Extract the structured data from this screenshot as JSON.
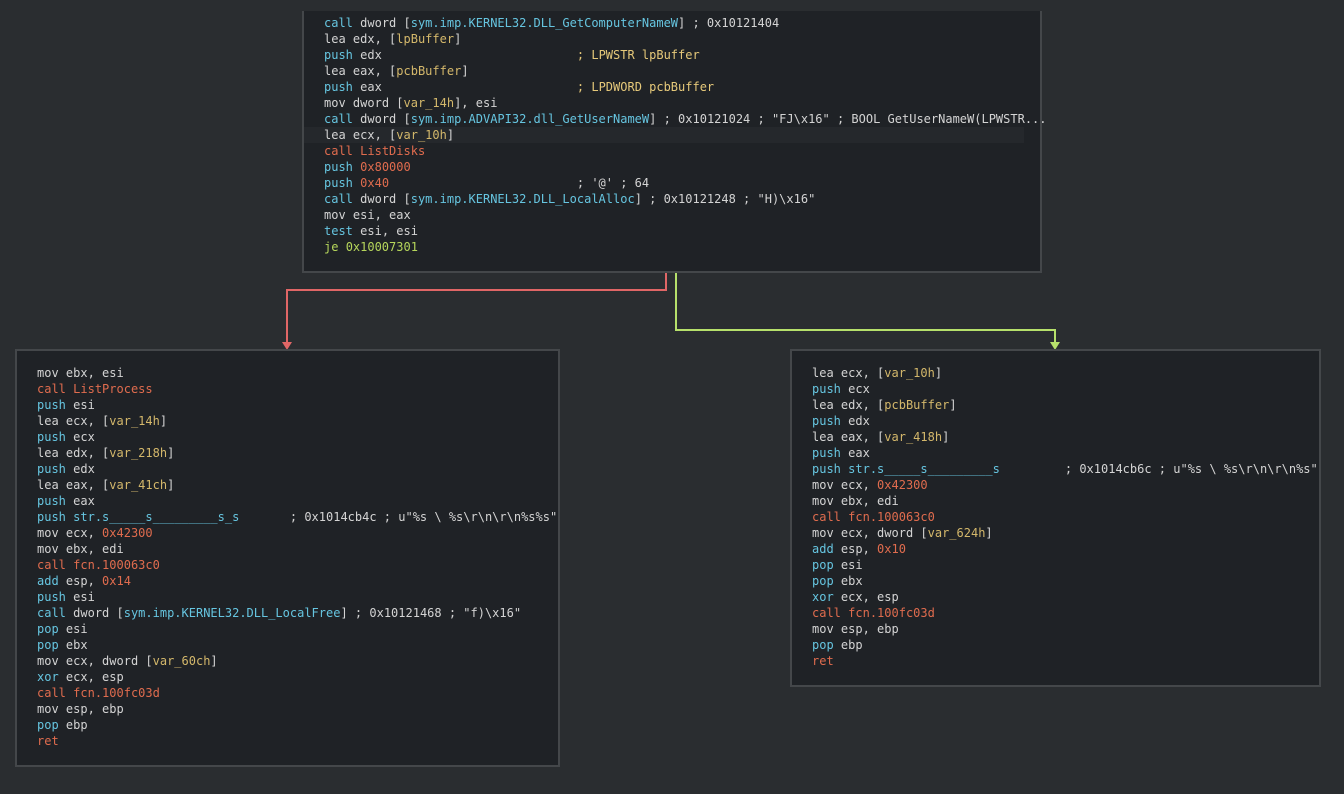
{
  "blocks": {
    "top": {
      "lines": [
        {
          "m": "call",
          "mk": "k-call-imp",
          "parts": [
            [
              "op",
              "dword ["
            ],
            [
              "imp",
              "sym.imp.KERNEL32.DLL_GetComputerNameW"
            ],
            [
              "op",
              "] ; 0x10121404"
            ]
          ]
        },
        {
          "m": "lea",
          "mk": "",
          "parts": [
            [
              "op",
              "edx, ["
            ],
            [
              "var",
              "lpBuffer"
            ],
            [
              "op",
              "]"
            ]
          ]
        },
        {
          "m": "push",
          "mk": "k-push",
          "parts": [
            [
              "op",
              "edx                           "
            ],
            [
              "cmt",
              "; LPWSTR lpBuffer"
            ]
          ]
        },
        {
          "m": "lea",
          "mk": "",
          "parts": [
            [
              "op",
              "eax, ["
            ],
            [
              "var",
              "pcbBuffer"
            ],
            [
              "op",
              "]"
            ]
          ]
        },
        {
          "m": "push",
          "mk": "k-push",
          "parts": [
            [
              "op",
              "eax                           "
            ],
            [
              "cmt",
              "; LPDWORD pcbBuffer"
            ]
          ]
        },
        {
          "m": "mov",
          "mk": "",
          "parts": [
            [
              "op",
              "dword ["
            ],
            [
              "var",
              "var_14h"
            ],
            [
              "op",
              "], esi"
            ]
          ]
        },
        {
          "m": "call",
          "mk": "k-call-imp",
          "parts": [
            [
              "op",
              "dword ["
            ],
            [
              "imp",
              "sym.imp.ADVAPI32.dll_GetUserNameW"
            ],
            [
              "op",
              "] ; 0x10121024 ; \"FJ\\x16\" ; BOOL GetUserNameW(LPWSTR..."
            ]
          ]
        },
        {
          "m": "lea",
          "mk": "",
          "hl": true,
          "parts": [
            [
              "op",
              "ecx, ["
            ],
            [
              "var",
              "var_10h"
            ],
            [
              "op",
              "]"
            ]
          ]
        },
        {
          "m": "call",
          "mk": "k-call-fn",
          "parts": [
            [
              "fn",
              "ListDisks"
            ]
          ]
        },
        {
          "m": "push",
          "mk": "k-push",
          "parts": [
            [
              "num",
              "0x80000"
            ]
          ]
        },
        {
          "m": "push",
          "mk": "k-push",
          "parts": [
            [
              "num",
              "0x40"
            ],
            [
              "op",
              "                          ; '@' ; 64"
            ]
          ]
        },
        {
          "m": "call",
          "mk": "k-call-imp",
          "parts": [
            [
              "op",
              "dword ["
            ],
            [
              "imp",
              "sym.imp.KERNEL32.DLL_LocalAlloc"
            ],
            [
              "op",
              "] ; 0x10121248 ; \"H)\\x16\""
            ]
          ]
        },
        {
          "m": "mov",
          "mk": "",
          "parts": [
            [
              "op",
              "esi, eax"
            ]
          ]
        },
        {
          "m": "test",
          "mk": "k-test",
          "parts": [
            [
              "op",
              "esi, esi"
            ]
          ]
        },
        {
          "m": "je",
          "mk": "k-je",
          "parts": [
            [
              "addr",
              "0x10007301"
            ]
          ]
        }
      ]
    },
    "left": {
      "lines": [
        {
          "m": "mov",
          "mk": "",
          "parts": [
            [
              "op",
              "ebx, esi"
            ]
          ]
        },
        {
          "m": "call",
          "mk": "k-call-fn",
          "parts": [
            [
              "fn",
              "ListProcess"
            ]
          ]
        },
        {
          "m": "push",
          "mk": "k-push",
          "parts": [
            [
              "op",
              "esi"
            ]
          ]
        },
        {
          "m": "lea",
          "mk": "",
          "parts": [
            [
              "op",
              "ecx, ["
            ],
            [
              "var",
              "var_14h"
            ],
            [
              "op",
              "]"
            ]
          ]
        },
        {
          "m": "push",
          "mk": "k-push",
          "parts": [
            [
              "op",
              "ecx"
            ]
          ]
        },
        {
          "m": "lea",
          "mk": "",
          "parts": [
            [
              "op",
              "edx, ["
            ],
            [
              "var",
              "var_218h"
            ],
            [
              "op",
              "]"
            ]
          ]
        },
        {
          "m": "push",
          "mk": "k-push",
          "parts": [
            [
              "op",
              "edx"
            ]
          ]
        },
        {
          "m": "lea",
          "mk": "",
          "parts": [
            [
              "op",
              "eax, ["
            ],
            [
              "var",
              "var_41ch"
            ],
            [
              "op",
              "]"
            ]
          ]
        },
        {
          "m": "push",
          "mk": "k-push",
          "parts": [
            [
              "op",
              "eax"
            ]
          ]
        },
        {
          "m": "push",
          "mk": "k-push",
          "parts": [
            [
              "str",
              "str.s_____s_________s_s"
            ],
            [
              "op",
              "       ; 0x1014cb4c ; u\"%s \\ %s\\r\\n\\r\\n%s%s\""
            ]
          ]
        },
        {
          "m": "mov",
          "mk": "",
          "parts": [
            [
              "op",
              "ecx, "
            ],
            [
              "num",
              "0x42300"
            ]
          ]
        },
        {
          "m": "mov",
          "mk": "",
          "parts": [
            [
              "op",
              "ebx, edi"
            ]
          ]
        },
        {
          "m": "call",
          "mk": "k-call-fn",
          "parts": [
            [
              "fn",
              "fcn.100063c0"
            ]
          ]
        },
        {
          "m": "add",
          "mk": "k-add",
          "parts": [
            [
              "op",
              "esp, "
            ],
            [
              "num",
              "0x14"
            ]
          ]
        },
        {
          "m": "push",
          "mk": "k-push",
          "parts": [
            [
              "op",
              "esi"
            ]
          ]
        },
        {
          "m": "call",
          "mk": "k-call-imp",
          "parts": [
            [
              "op",
              "dword ["
            ],
            [
              "imp",
              "sym.imp.KERNEL32.DLL_LocalFree"
            ],
            [
              "op",
              "] ; 0x10121468 ; \"f)\\x16\""
            ]
          ]
        },
        {
          "m": "pop",
          "mk": "k-pop",
          "parts": [
            [
              "op",
              "esi"
            ]
          ]
        },
        {
          "m": "pop",
          "mk": "k-pop",
          "parts": [
            [
              "op",
              "ebx"
            ]
          ]
        },
        {
          "m": "mov",
          "mk": "",
          "parts": [
            [
              "op",
              "ecx, dword ["
            ],
            [
              "var",
              "var_60ch"
            ],
            [
              "op",
              "]"
            ]
          ]
        },
        {
          "m": "xor",
          "mk": "k-xor",
          "parts": [
            [
              "op",
              "ecx, esp"
            ]
          ]
        },
        {
          "m": "call",
          "mk": "k-call-fn",
          "parts": [
            [
              "fn",
              "fcn.100fc03d"
            ]
          ]
        },
        {
          "m": "mov",
          "mk": "",
          "parts": [
            [
              "op",
              "esp, ebp"
            ]
          ]
        },
        {
          "m": "pop",
          "mk": "k-pop",
          "parts": [
            [
              "op",
              "ebp"
            ]
          ]
        },
        {
          "m": "ret",
          "mk": "k-ret",
          "parts": []
        }
      ]
    },
    "right": {
      "lines": [
        {
          "m": "lea",
          "mk": "",
          "parts": [
            [
              "op",
              "ecx, ["
            ],
            [
              "var",
              "var_10h"
            ],
            [
              "op",
              "]"
            ]
          ]
        },
        {
          "m": "push",
          "mk": "k-push",
          "parts": [
            [
              "op",
              "ecx"
            ]
          ]
        },
        {
          "m": "lea",
          "mk": "",
          "parts": [
            [
              "op",
              "edx, ["
            ],
            [
              "var",
              "pcbBuffer"
            ],
            [
              "op",
              "]"
            ]
          ]
        },
        {
          "m": "push",
          "mk": "k-push",
          "parts": [
            [
              "op",
              "edx"
            ]
          ]
        },
        {
          "m": "lea",
          "mk": "",
          "parts": [
            [
              "op",
              "eax, ["
            ],
            [
              "var",
              "var_418h"
            ],
            [
              "op",
              "]"
            ]
          ]
        },
        {
          "m": "push",
          "mk": "k-push",
          "parts": [
            [
              "op",
              "eax"
            ]
          ]
        },
        {
          "m": "push",
          "mk": "k-push",
          "parts": [
            [
              "str",
              "str.s_____s_________s"
            ],
            [
              "op",
              "         ; 0x1014cb6c ; u\"%s \\ %s\\r\\n\\r\\n%s\""
            ]
          ]
        },
        {
          "m": "mov",
          "mk": "",
          "parts": [
            [
              "op",
              "ecx, "
            ],
            [
              "num",
              "0x42300"
            ]
          ]
        },
        {
          "m": "mov",
          "mk": "",
          "parts": [
            [
              "op",
              "ebx, edi"
            ]
          ]
        },
        {
          "m": "call",
          "mk": "k-call-fn",
          "parts": [
            [
              "fn",
              "fcn.100063c0"
            ]
          ]
        },
        {
          "m": "mov",
          "mk": "",
          "parts": [
            [
              "op",
              "ecx, dword ["
            ],
            [
              "var",
              "var_624h"
            ],
            [
              "op",
              "]"
            ]
          ]
        },
        {
          "m": "add",
          "mk": "k-add",
          "parts": [
            [
              "op",
              "esp, "
            ],
            [
              "num",
              "0x10"
            ]
          ]
        },
        {
          "m": "pop",
          "mk": "k-pop",
          "parts": [
            [
              "op",
              "esi"
            ]
          ]
        },
        {
          "m": "pop",
          "mk": "k-pop",
          "parts": [
            [
              "op",
              "ebx"
            ]
          ]
        },
        {
          "m": "xor",
          "mk": "k-xor",
          "parts": [
            [
              "op",
              "ecx, esp"
            ]
          ]
        },
        {
          "m": "call",
          "mk": "k-call-fn",
          "parts": [
            [
              "fn",
              "fcn.100fc03d"
            ]
          ]
        },
        {
          "m": "mov",
          "mk": "",
          "parts": [
            [
              "op",
              "esp, ebp"
            ]
          ]
        },
        {
          "m": "pop",
          "mk": "k-pop",
          "parts": [
            [
              "op",
              "ebp"
            ]
          ]
        },
        {
          "m": "ret",
          "mk": "k-ret",
          "parts": []
        }
      ]
    }
  },
  "edges": {
    "false_branch_color": "#e06666",
    "true_branch_color": "#b6e06b"
  }
}
